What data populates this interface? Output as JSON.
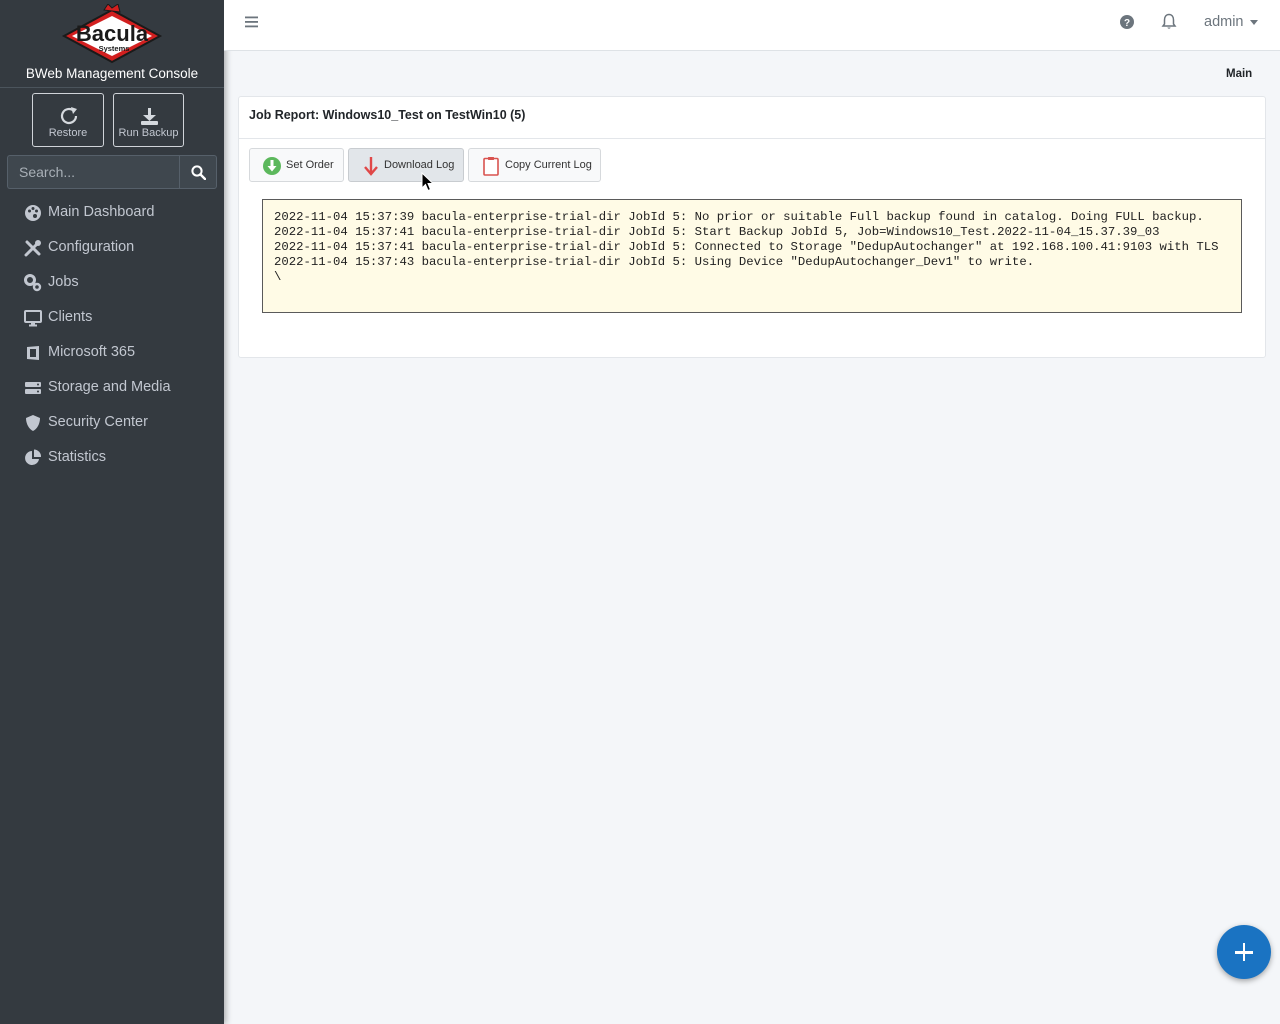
{
  "brand": {
    "logo_text": "Bacula",
    "logo_subtext": "Systems",
    "console_title": "BWeb Management Console"
  },
  "quick_actions": [
    {
      "label": "Restore",
      "icon": "refresh-icon"
    },
    {
      "label": "Run Backup",
      "icon": "download-icon"
    }
  ],
  "search": {
    "placeholder": "Search...",
    "value": ""
  },
  "nav": [
    {
      "label": "Main Dashboard",
      "icon": "palette-icon"
    },
    {
      "label": "Configuration",
      "icon": "tools-icon"
    },
    {
      "label": "Jobs",
      "icon": "gears-icon"
    },
    {
      "label": "Clients",
      "icon": "desktop-icon"
    },
    {
      "label": "Microsoft 365",
      "icon": "office-icon"
    },
    {
      "label": "Storage and Media",
      "icon": "hdd-icon"
    },
    {
      "label": "Security Center",
      "icon": "shield-icon"
    },
    {
      "label": "Statistics",
      "icon": "pie-chart-icon"
    }
  ],
  "topbar": {
    "user": "admin"
  },
  "breadcrumb": "Main",
  "card": {
    "title": "Job Report: Windows10_Test on TestWin10 (5)",
    "buttons": [
      {
        "label": "Set Order",
        "icon": "arrow-down-circle-icon"
      },
      {
        "label": "Download Log",
        "icon": "arrow-down-icon"
      },
      {
        "label": "Copy Current Log",
        "icon": "clipboard-icon"
      }
    ],
    "log_lines": [
      "2022-11-04 15:37:39 bacula-enterprise-trial-dir JobId 5: No prior or suitable Full backup found in catalog. Doing FULL backup.",
      "2022-11-04 15:37:41 bacula-enterprise-trial-dir JobId 5: Start Backup JobId 5, Job=Windows10_Test.2022-11-04_15.37.39_03",
      "2022-11-04 15:37:41 bacula-enterprise-trial-dir JobId 5: Connected to Storage \"DedupAutochanger\" at 192.168.100.41:9103 with TLS",
      "2022-11-04 15:37:43 bacula-enterprise-trial-dir JobId 5: Using Device \"DedupAutochanger_Dev1\" to write.",
      "\\"
    ]
  },
  "colors": {
    "sidebar_bg": "#343a40",
    "accent": "#1a73c2",
    "log_bg": "#fffbe6"
  }
}
